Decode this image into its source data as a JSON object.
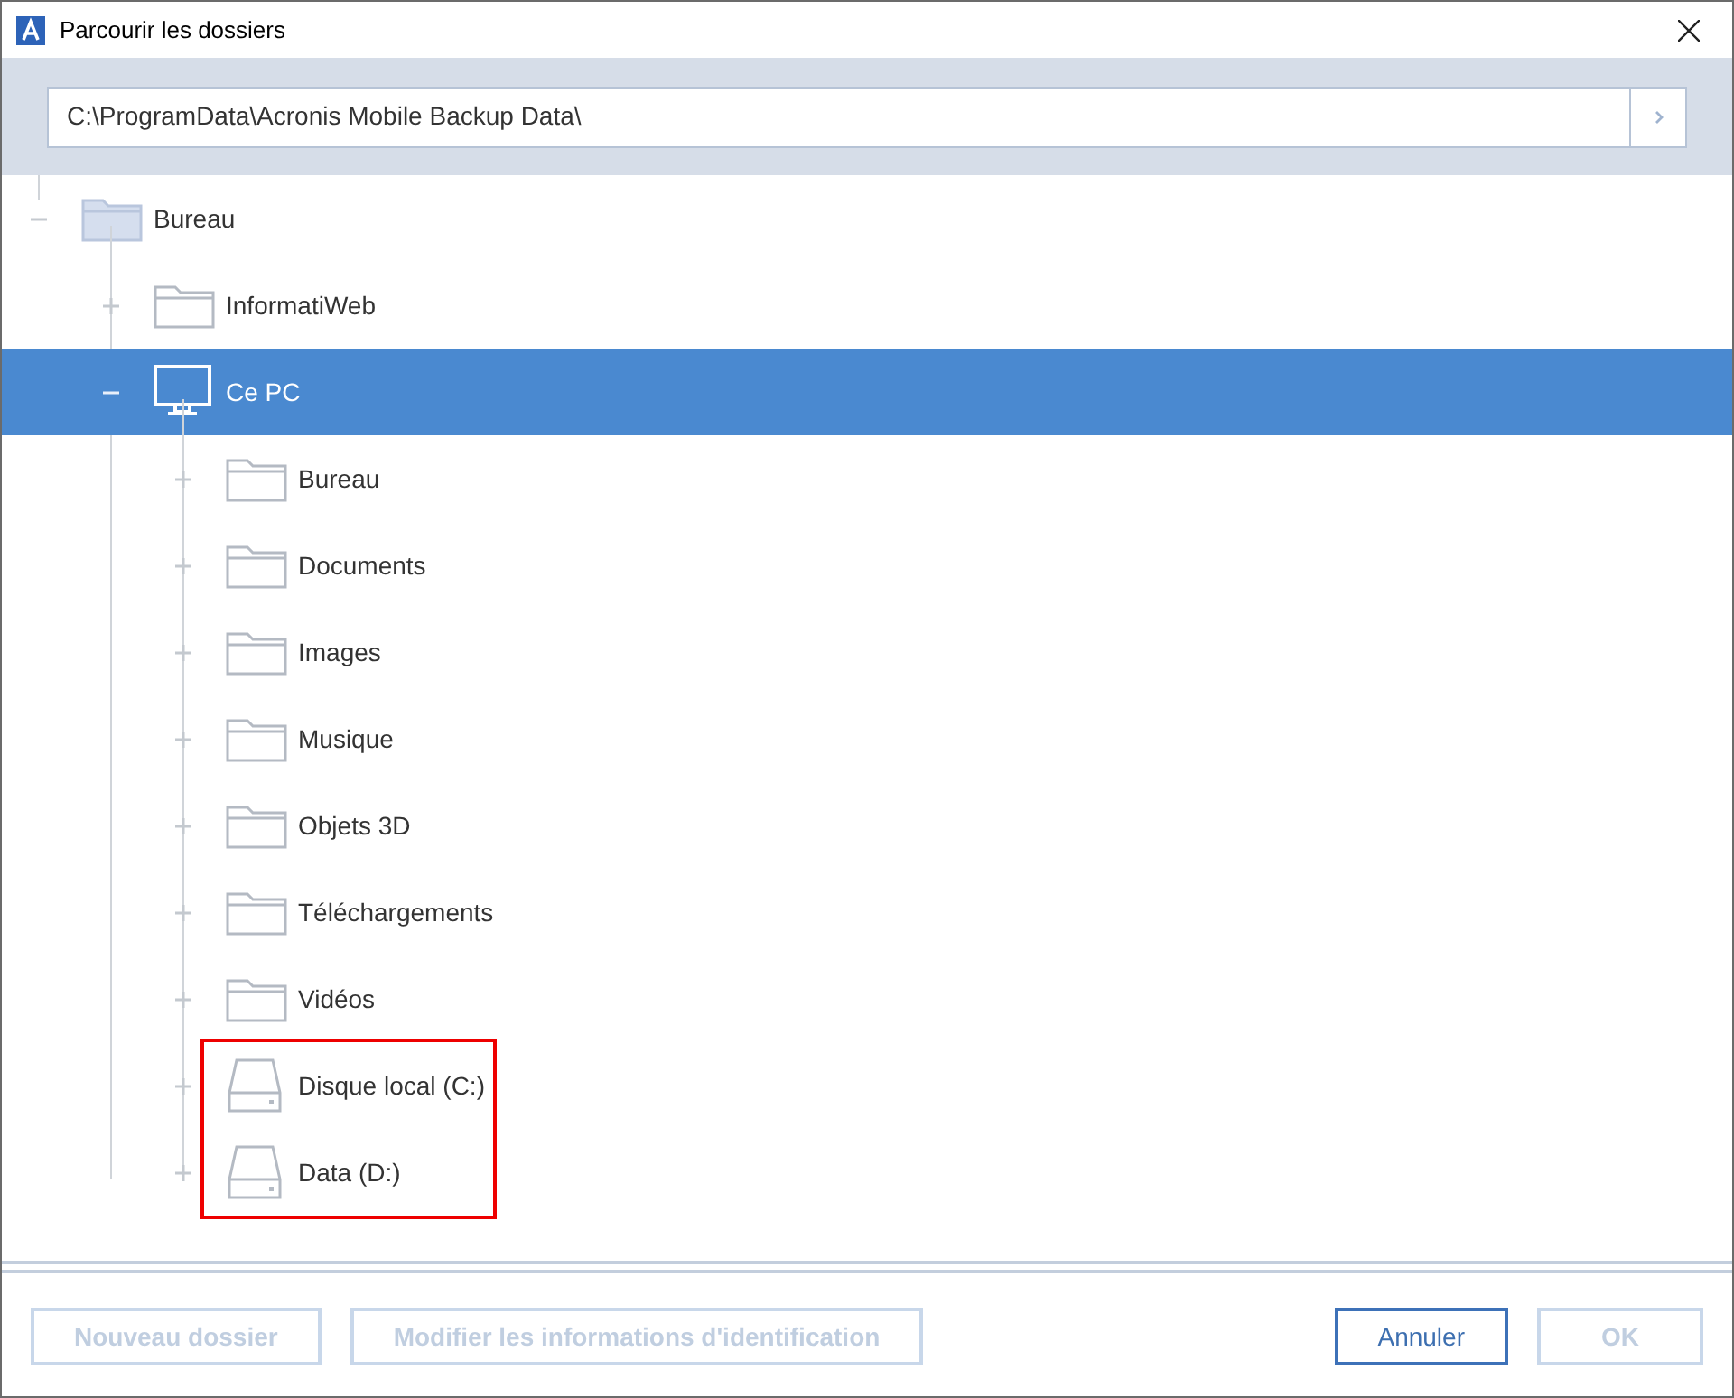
{
  "window": {
    "title": "Parcourir les dossiers"
  },
  "path": {
    "value": "C:\\ProgramData\\Acronis Mobile Backup Data\\"
  },
  "tree": [
    {
      "label": "Bureau",
      "kind": "desktop",
      "expanded": true,
      "selected": false,
      "highlighted": false,
      "children": [
        {
          "label": "InformatiWeb",
          "kind": "folder",
          "expanded": false,
          "selected": false,
          "highlighted": false
        },
        {
          "label": "Ce PC",
          "kind": "computer",
          "expanded": true,
          "selected": true,
          "highlighted": false,
          "children": [
            {
              "label": "Bureau",
              "kind": "folder",
              "expanded": false,
              "selected": false,
              "highlighted": false
            },
            {
              "label": "Documents",
              "kind": "folder",
              "expanded": false,
              "selected": false,
              "highlighted": false
            },
            {
              "label": "Images",
              "kind": "folder",
              "expanded": false,
              "selected": false,
              "highlighted": false
            },
            {
              "label": "Musique",
              "kind": "folder",
              "expanded": false,
              "selected": false,
              "highlighted": false
            },
            {
              "label": "Objets 3D",
              "kind": "folder",
              "expanded": false,
              "selected": false,
              "highlighted": false
            },
            {
              "label": "Téléchargements",
              "kind": "folder",
              "expanded": false,
              "selected": false,
              "highlighted": false
            },
            {
              "label": "Vidéos",
              "kind": "folder",
              "expanded": false,
              "selected": false,
              "highlighted": false
            },
            {
              "label": "Disque local (C:)",
              "kind": "drive",
              "expanded": false,
              "selected": false,
              "highlighted": true
            },
            {
              "label": "Data (D:)",
              "kind": "drive",
              "expanded": false,
              "selected": false,
              "highlighted": true
            }
          ]
        }
      ]
    }
  ],
  "left_buttons": [
    {
      "label": "Nouveau dossier",
      "disabled": true
    },
    {
      "label": "Modifier les informations d'identification",
      "disabled": true
    }
  ],
  "right_buttons": [
    {
      "label": "Annuler",
      "disabled": false
    },
    {
      "label": "OK",
      "disabled": true
    }
  ]
}
